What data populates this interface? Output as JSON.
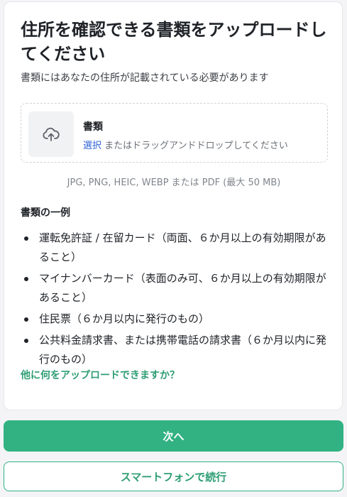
{
  "page": {
    "title": "住所を確認できる書類をアップロードしてください",
    "subtitle": "書類にはあなたの住所が記載されている必要があります"
  },
  "dropzone": {
    "icon": "cloud-upload-icon",
    "title": "書類",
    "select_link": "選択",
    "hint": " またはドラッグアンドドロップしてください",
    "formats": "JPG, PNG, HEIC, WEBP または PDF (最大 50 MB)"
  },
  "examples": {
    "heading": "書類の一例",
    "items": [
      "運転免許証 / 在留カード（両面、６か月以上の有効期限があること）",
      "マイナンバーカード（表面のみ可、６か月以上の有効期限があること）",
      "住民票（６か月以内に発行のもの）",
      "公共料金請求書、または携帯電話の請求書（６か月以内に発行のもの）"
    ]
  },
  "help_link": "他に何をアップロードできますか？",
  "buttons": {
    "next": "次へ",
    "continue_phone": "スマートフォンで続行"
  },
  "colors": {
    "accent": "#32b283",
    "link": "#2c61d6"
  }
}
